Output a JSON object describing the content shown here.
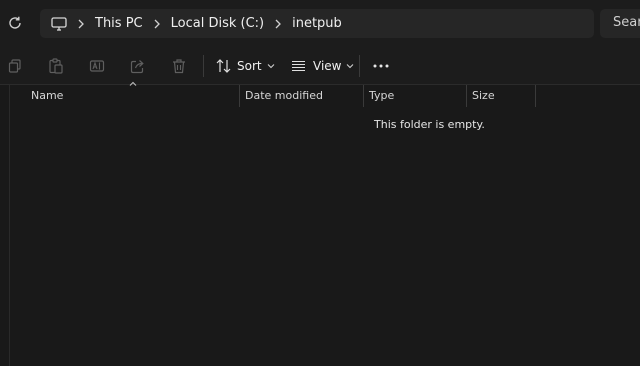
{
  "address": {
    "crumbs": [
      "This PC",
      "Local Disk (C:)",
      "inetpub"
    ]
  },
  "search": {
    "placeholder": "Search"
  },
  "toolbar": {
    "sort_label": "Sort",
    "view_label": "View"
  },
  "columns": [
    "Name",
    "Date modified",
    "Type",
    "Size"
  ],
  "empty_message": "This folder is empty.",
  "icons": {
    "refresh": "refresh-icon",
    "computer": "computer-icon",
    "copy": "copy-icon",
    "paste": "paste-icon",
    "rename": "rename-icon",
    "share": "share-icon",
    "delete": "delete-icon",
    "sort": "sort-icon",
    "view": "view-icon",
    "more": "more-icon"
  },
  "colors": {
    "background": "#191919",
    "bar": "#1c1c1c",
    "field": "#262626",
    "text": "#f0f0f0",
    "disabled": "#5f5f5f"
  }
}
